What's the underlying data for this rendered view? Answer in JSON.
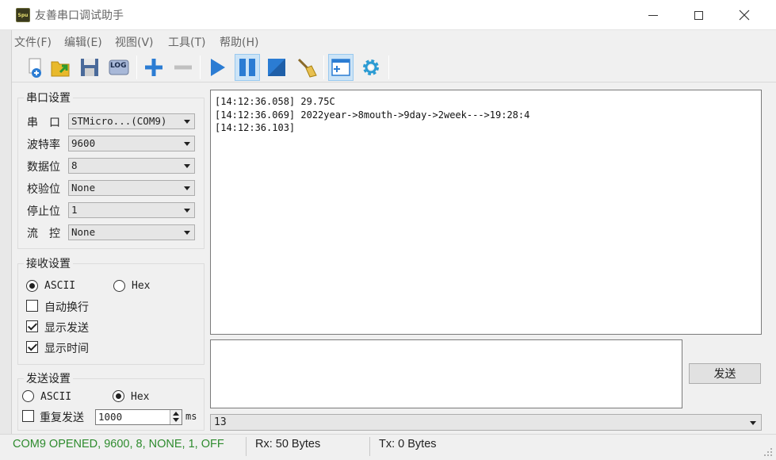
{
  "window": {
    "icon_text": "Spu",
    "title": "友善串口调试助手"
  },
  "menu": [
    "文件(F)",
    "编辑(E)",
    "视图(V)",
    "工具(T)",
    "帮助(H)"
  ],
  "toolbar": {
    "log_label": "LOG",
    "colors": {
      "blue": "#2b7cd3",
      "yellow": "#e8b92b",
      "gray": "#c0c0c0"
    }
  },
  "serial_settings": {
    "title": "串口设置",
    "rows": [
      {
        "label": "串　口",
        "value": "STMicro...(COM9)"
      },
      {
        "label": "波特率",
        "value": "9600"
      },
      {
        "label": "数据位",
        "value": "8"
      },
      {
        "label": "校验位",
        "value": "None"
      },
      {
        "label": "停止位",
        "value": "1"
      },
      {
        "label": "流　控",
        "value": "None"
      }
    ]
  },
  "receive_settings": {
    "title": "接收设置",
    "ascii_label": "ASCII",
    "hex_label": "Hex",
    "selected": "ASCII",
    "auto_wrap_label": "自动换行",
    "auto_wrap": false,
    "show_send_label": "显示发送",
    "show_send": true,
    "show_time_label": "显示时间",
    "show_time": true
  },
  "send_settings": {
    "title": "发送设置",
    "ascii_label": "ASCII",
    "hex_label": "Hex",
    "selected": "Hex",
    "repeat_label": "重复发送",
    "repeat": false,
    "interval": "1000",
    "interval_unit": "ms"
  },
  "receive_log": [
    "[14:12:36.058] 29.75C",
    "[14:12:36.069] 2022year->8mouth->9day->2week--->19:28:4",
    "[14:12:36.103]"
  ],
  "send": {
    "text": "",
    "button_label": "发送",
    "history_value": "13"
  },
  "status": {
    "connection": "COM9 OPENED, 9600, 8, NONE, 1, OFF",
    "connection_color": "#2e8b2e",
    "rx": "Rx: 50 Bytes",
    "tx": "Tx: 0 Bytes"
  }
}
